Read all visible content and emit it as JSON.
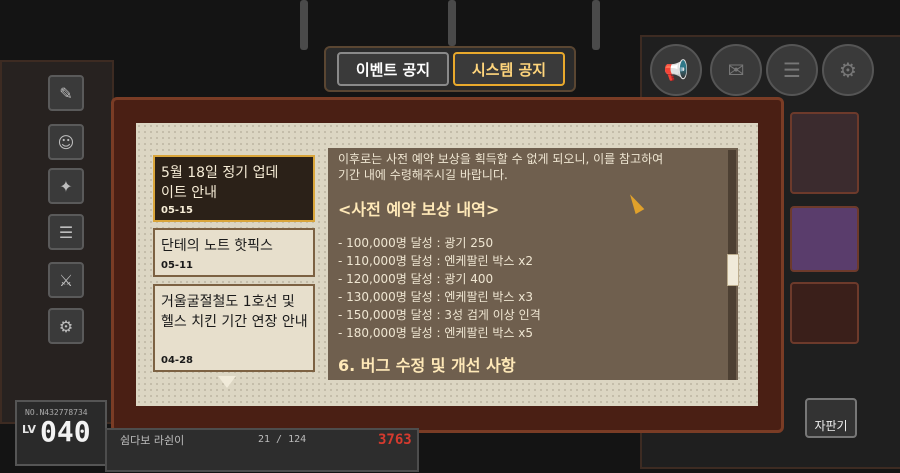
{
  "tabs": {
    "event": "이벤트 공지",
    "system": "시스템 공지"
  },
  "notices": [
    {
      "title": "5월 18일 정기 업데이트 안내",
      "date": "05-15"
    },
    {
      "title": "단테의 노트 핫픽스",
      "date": "05-11"
    },
    {
      "title": "거울굴절철도 1호선 및 헬스 치킨 기간 연장 안내",
      "date": "04-28"
    }
  ],
  "content": {
    "intro_line1": "이후로는 사전 예약 보상을 획득할 수 없게 되오니, 이를 참고하여",
    "intro_line2": "기간 내에 수령해주시길 바랍니다.",
    "section_title": "<사전 예약 보상 내역>",
    "rewards": [
      "- 100,000명 달성 : 광기 250",
      "- 110,000명 달성 : 엔케팔린 박스 x2",
      "- 120,000명 달성 : 광기 400",
      "- 130,000명 달성 : 엔케팔린 박스 x3",
      "- 150,000명 달성 : 3성 검게 이상 인격",
      "- 180,000명 달성 : 엔케팔린 박스 x5"
    ],
    "next_section": "6. 버그 수정 및 개선 사항"
  },
  "status": {
    "uid": "NO.N432778734",
    "lv_label": "LV",
    "level": "040",
    "exp": "21 / 124",
    "currency": "3763",
    "vend_label": "자판기",
    "user_name": "쉼다보 라쉰이"
  },
  "colors": {
    "selected_border": "#d9a53a",
    "dialog_frame": "#4a1f14"
  }
}
